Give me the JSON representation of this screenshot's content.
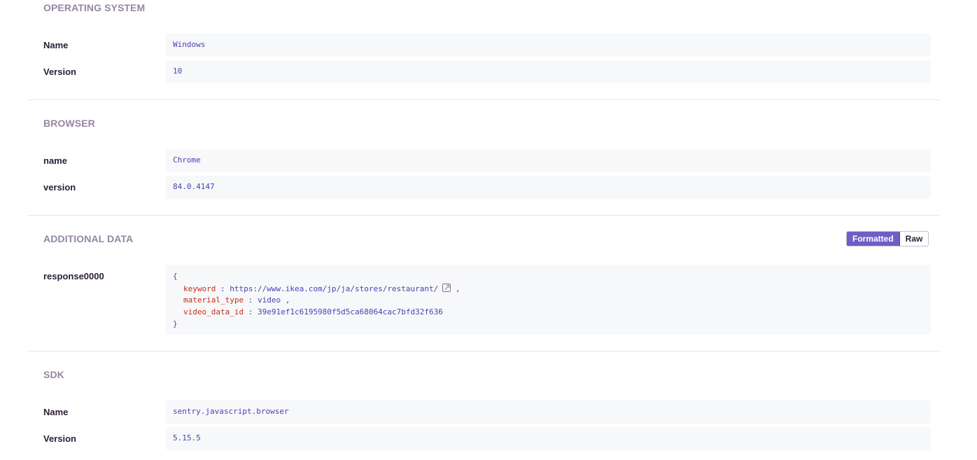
{
  "os": {
    "title": "OPERATING SYSTEM",
    "rows": [
      {
        "key": "Name",
        "value": "Windows"
      },
      {
        "key": "Version",
        "value": "10"
      }
    ]
  },
  "browser": {
    "title": "BROWSER",
    "rows": [
      {
        "key": "name",
        "value": "Chrome"
      },
      {
        "key": "version",
        "value": "84.0.4147"
      }
    ]
  },
  "additional": {
    "title": "ADDITIONAL DATA",
    "toggle": {
      "formatted": "Formatted",
      "raw": "Raw"
    },
    "key": "response0000",
    "json": {
      "open_brace": "{",
      "close_brace": "}",
      "lines": [
        {
          "key": "keyword",
          "sep": ":",
          "value": "https://www.ikea.com/jp/ja/stores/restaurant/",
          "trail": ","
        },
        {
          "key": "material_type",
          "sep": ":",
          "value": "video",
          "trail": ","
        },
        {
          "key": "video_data_id",
          "sep": ":",
          "value": "39e91ef1c6195980f5d5ca68064cac7bfd32f636",
          "trail": ""
        }
      ]
    }
  },
  "sdk": {
    "title": "SDK",
    "rows": [
      {
        "key": "Name",
        "value": "sentry.javascript.browser"
      },
      {
        "key": "Version",
        "value": "5.15.5"
      }
    ]
  },
  "colors": {
    "title": "#9585a3",
    "key": "#2b1d38",
    "value": "#4e3fb4",
    "json_key": "#c02e1d",
    "accent": "#6c5fc7"
  }
}
